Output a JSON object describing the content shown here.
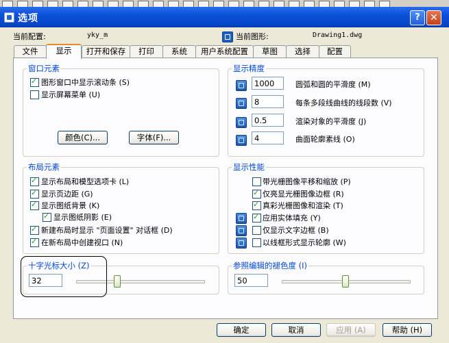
{
  "window": {
    "title": "选项",
    "help_label": "?",
    "close_label": "✕"
  },
  "header": {
    "profile_label": "当前配置:",
    "profile_value": "yky_m",
    "drawing_label": "当前图形:",
    "drawing_value": "Drawing1.dwg"
  },
  "tabs": [
    "文件",
    "显示",
    "打开和保存",
    "打印",
    "系统",
    "用户系统配置",
    "草图",
    "选择",
    "配置"
  ],
  "active_tab": "显示",
  "window_elements": {
    "title": "窗口元素",
    "checkboxes": [
      {
        "label": "图形窗口中显示滚动条 (S)",
        "checked": true
      },
      {
        "label": "显示屏幕菜单 (U)",
        "checked": false
      }
    ],
    "colors_button": "颜色(C)...",
    "fonts_button": "字体(F)..."
  },
  "display_resolution": {
    "title": "显示精度",
    "items": [
      {
        "value": "1000",
        "label": "圆弧和圆的平滑度 (M)"
      },
      {
        "value": "8",
        "label": "每条多段线曲线的线段数 (V)"
      },
      {
        "value": "0.5",
        "label": "渲染对象的平滑度 (J)"
      },
      {
        "value": "4",
        "label": "曲面轮廓素线 (O)"
      }
    ]
  },
  "layout_elements": {
    "title": "布局元素",
    "checkboxes": [
      {
        "label": "显示布局和模型选项卡 (L)",
        "checked": true
      },
      {
        "label": "显示页边距 (G)",
        "checked": true
      },
      {
        "label": "显示图纸背景 (K)",
        "checked": true
      },
      {
        "label": "显示图纸阴影 (E)",
        "checked": true
      },
      {
        "label": "新建布局时显示 \"页面设置\" 对话框 (D)",
        "checked": true
      },
      {
        "label": "在新布局中创建视口 (N)",
        "checked": true
      }
    ]
  },
  "display_performance": {
    "title": "显示性能",
    "checkboxes": [
      {
        "label": "带光栅图像平移和缩放 (P)",
        "checked": false
      },
      {
        "label": "仅亮显光栅图像边框 (R)",
        "checked": true
      },
      {
        "label": "真彩光栅图像和渲染 (T)",
        "checked": true
      },
      {
        "label": "应用实体填充 (Y)",
        "checked": true
      },
      {
        "label": "仅显示文字边框 (B)",
        "checked": false
      },
      {
        "label": "以线框形式显示轮廓 (W)",
        "checked": false
      }
    ]
  },
  "crosshair": {
    "title": "十字光标大小 (Z)",
    "value": "32",
    "slider_fraction": 0.32
  },
  "xref_fade": {
    "title": "参照编辑的褪色度 (I)",
    "value": "50",
    "slider_fraction": 0.5
  },
  "footer": {
    "ok": "确定",
    "cancel": "取消",
    "apply": "应用 (A)",
    "help": "帮助 (H)"
  }
}
